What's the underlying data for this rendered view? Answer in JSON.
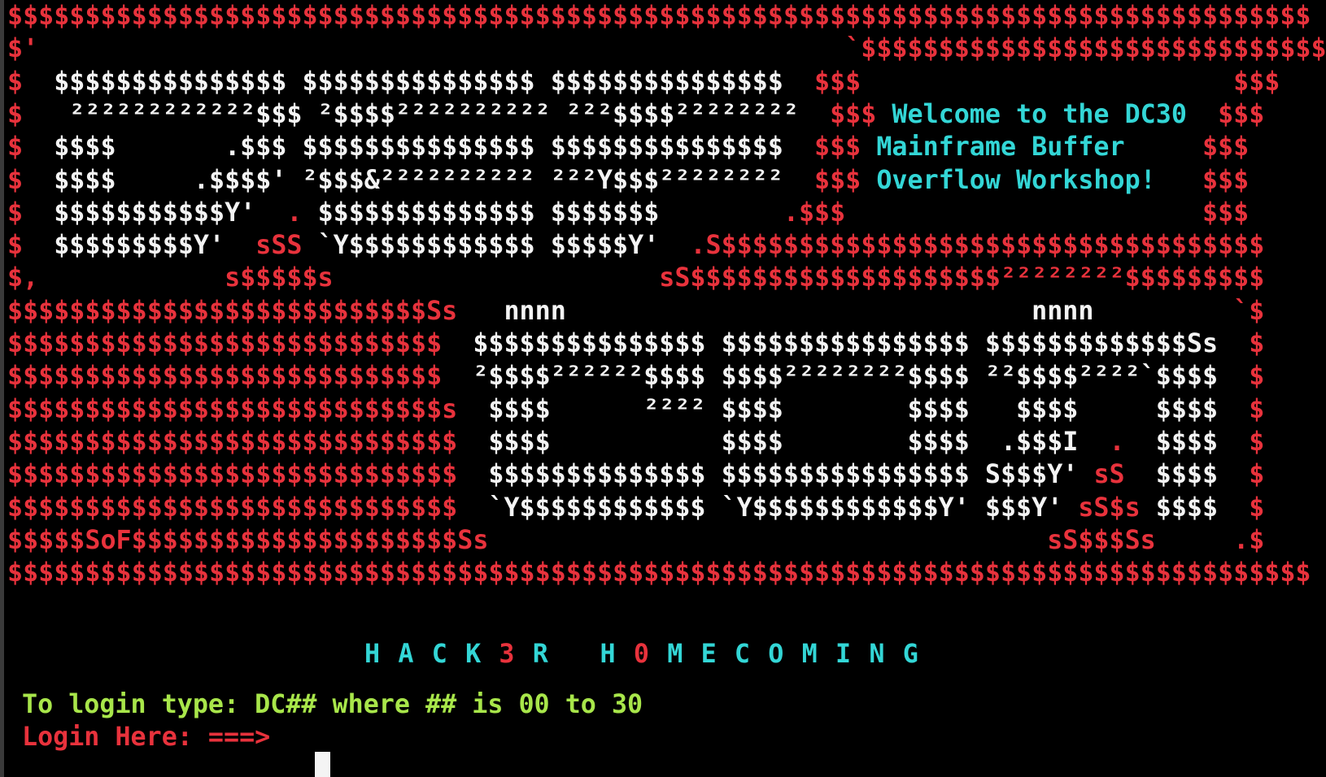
{
  "colors": {
    "background": "#000000",
    "red": "#e8323c",
    "white": "#f4f4f4",
    "cyan": "#33d6d6",
    "green": "#a8e64a"
  },
  "art": [
    [
      [
        "r",
        "$$$$$$$$$$$$$$$$$$$$$$$$$$$$$$$$$$$$$$$$$$$$$$$$$$$$$$$$$$$$$$$$$$$$$$$$$$$$$$$$$$$$"
      ]
    ],
    [
      [
        "r",
        "$'                                                    `$$$$$$$$$$$$$$$$$$$$$$$$$$$$$$"
      ]
    ],
    [
      [
        "r",
        "$  "
      ],
      [
        "w",
        "$$$$$$$$$$$$$$$ $$$$$$$$$$$$$$$ $$$$$$$$$$$$$$$  "
      ],
      [
        "r",
        "$$$                        $$$"
      ]
    ],
    [
      [
        "r",
        "$  "
      ],
      [
        "w",
        " ²²²²²²²²²²²²$$$ ²$$$$²²²²²²²²²² ²²²$$$$²²²²²²²²  "
      ],
      [
        "r",
        "$$$ "
      ],
      [
        "c",
        "Welcome to the DC30  "
      ],
      [
        "r",
        "$$$"
      ]
    ],
    [
      [
        "r",
        "$  "
      ],
      [
        "w",
        "$$$$       .$$$ $$$$$$$$$$$$$$$ $$$$$$$$$$$$$$$  "
      ],
      [
        "r",
        "$$$ "
      ],
      [
        "c",
        "Mainframe Buffer     "
      ],
      [
        "r",
        "$$$"
      ]
    ],
    [
      [
        "r",
        "$  "
      ],
      [
        "w",
        "$$$$     .$$$$' ²$$$&²²²²²²²²²² ²²²Y$$$²²²²²²²²  "
      ],
      [
        "r",
        "$$$ "
      ],
      [
        "c",
        "Overflow Workshop!   "
      ],
      [
        "r",
        "$$$"
      ]
    ],
    [
      [
        "r",
        "$  "
      ],
      [
        "w",
        "$$$$$$$$$$$Y'  "
      ],
      [
        "r",
        ". "
      ],
      [
        "w",
        "$$$$$$$$$$$$$$ $$$$$$$        "
      ],
      [
        "r",
        ".$$$                       $$$"
      ]
    ],
    [
      [
        "r",
        "$  "
      ],
      [
        "w",
        "$$$$$$$$$Y'  "
      ],
      [
        "r",
        "sSS "
      ],
      [
        "w",
        "`Y$$$$$$$$$$$$ $$$$$Y'  "
      ],
      [
        "r",
        ".S$$$$$$$$$$$$$$$$$$$$$$$$$$$$$$$$$$$"
      ]
    ],
    [
      [
        "r",
        "$,            s$$$$$s                     sS$$$$$$$$$$$$$$$$$$$$²²²²²²²²$$$$$$$$$"
      ]
    ],
    [
      [
        "r",
        "$$$$$$$$$$$$$$$$$$$$$$$$$$$Ss   "
      ],
      [
        "w",
        "nnnn                              nnnn         "
      ],
      [
        "r",
        "`$"
      ]
    ],
    [
      [
        "r",
        "$$$$$$$$$$$$$$$$$$$$$$$$$$$$  "
      ],
      [
        "w",
        "$$$$$$$$$$$$$$$ $$$$$$$$$$$$$$$$ $$$$$$$$$$$$$Ss  "
      ],
      [
        "r",
        "$"
      ]
    ],
    [
      [
        "r",
        "$$$$$$$$$$$$$$$$$$$$$$$$$$$$  "
      ],
      [
        "w",
        "²$$$$²²²²²²$$$$ $$$$²²²²²²²²$$$$ ²²$$$$²²²²`$$$$  "
      ],
      [
        "r",
        "$"
      ]
    ],
    [
      [
        "r",
        "$$$$$$$$$$$$$$$$$$$$$$$$$$$$s  "
      ],
      [
        "w",
        "$$$$      ²²²² $$$$        $$$$   $$$$     $$$$  "
      ],
      [
        "r",
        "$"
      ]
    ],
    [
      [
        "r",
        "$$$$$$$$$$$$$$$$$$$$$$$$$$$$$  "
      ],
      [
        "w",
        "$$$$           $$$$        $$$$  .$$$I  "
      ],
      [
        "r",
        ".  "
      ],
      [
        "w",
        "$$$$  "
      ],
      [
        "r",
        "$"
      ]
    ],
    [
      [
        "r",
        "$$$$$$$$$$$$$$$$$$$$$$$$$$$$$  "
      ],
      [
        "w",
        "$$$$$$$$$$$$$$ $$$$$$$$$$$$$$$$ S$$$Y' "
      ],
      [
        "r",
        "sS  "
      ],
      [
        "w",
        "$$$$  "
      ],
      [
        "r",
        "$"
      ]
    ],
    [
      [
        "r",
        "$$$$$$$$$$$$$$$$$$$$$$$$$$$$$  "
      ],
      [
        "w",
        "`Y$$$$$$$$$$$$ `Y$$$$$$$$$$$$Y' $$$Y' "
      ],
      [
        "r",
        "sS$s "
      ],
      [
        "w",
        "$$$$  "
      ],
      [
        "r",
        "$"
      ]
    ],
    [
      [
        "r",
        "$$$$$SoF$$$$$$$$$$$$$$$$$$$$$Ss                                    sS$$$Ss     .$"
      ]
    ],
    [
      [
        "r",
        "$$$$$$$$$$$$$$$$$$$$$$$$$$$$$$$$$$$$$$$$$$$$$$$$$$$$$$$$$$$$$$$$$$$$$$$$$$$$$$$$$$$$"
      ]
    ]
  ],
  "banner": [
    [
      "c",
      "H A C K "
    ],
    [
      "r",
      "3"
    ],
    [
      "c",
      " R   H "
    ],
    [
      "r",
      "0"
    ],
    [
      "c",
      " M E C O M I N G"
    ]
  ],
  "login_instruction": "To login type: DC## where ## is 00 to 30",
  "login_prompt": "Login Here: ===>"
}
